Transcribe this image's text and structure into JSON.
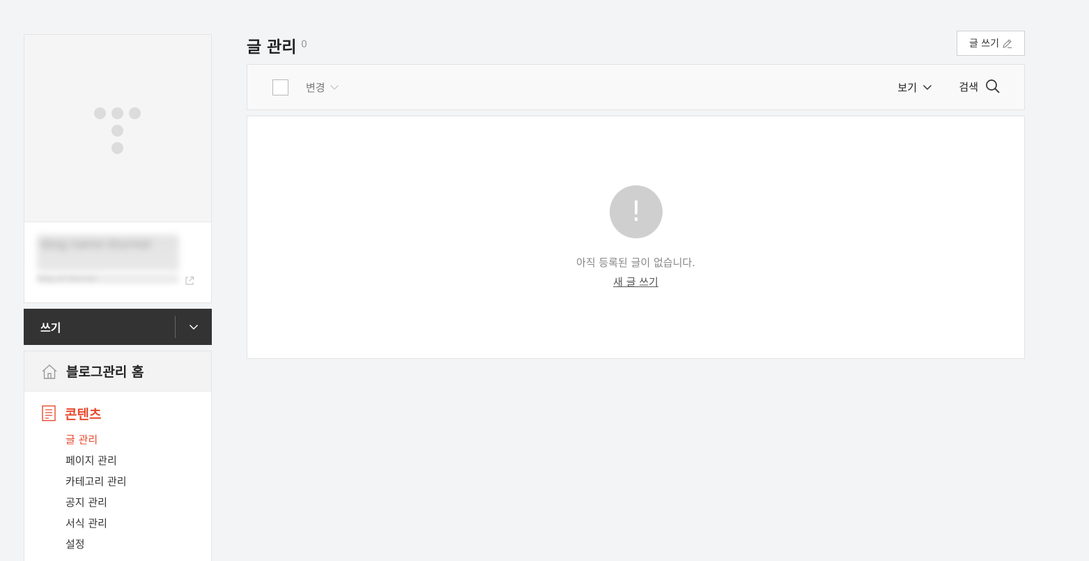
{
  "sidebar": {
    "blog_name": "blog name blurred",
    "blog_url": "blog url blurred",
    "write_label": "쓰기",
    "home_label": "블로그관리 홈",
    "section": {
      "label": "콘텐츠",
      "items": [
        {
          "label": "글 관리",
          "active": true
        },
        {
          "label": "페이지 관리",
          "active": false
        },
        {
          "label": "카테고리 관리",
          "active": false
        },
        {
          "label": "공지 관리",
          "active": false
        },
        {
          "label": "서식 관리",
          "active": false
        },
        {
          "label": "설정",
          "active": false
        }
      ]
    }
  },
  "header": {
    "title": "글 관리",
    "count": "0",
    "write_button": "글 쓰기"
  },
  "toolbar": {
    "change_label": "변경",
    "view_label": "보기",
    "search_label": "검색"
  },
  "content": {
    "empty_icon": "!",
    "empty_message": "아직 등록된 글이 없습니다.",
    "new_post_link": "새 글 쓰기"
  },
  "colors": {
    "accent": "#e8492d",
    "dark_bar": "#333333",
    "background": "#f3f4f6"
  },
  "icons": [
    "tistory-logo-icon",
    "external-link-icon",
    "chevron-down-icon",
    "home-icon",
    "document-icon",
    "pencil-icon",
    "search-icon",
    "exclamation-icon"
  ]
}
